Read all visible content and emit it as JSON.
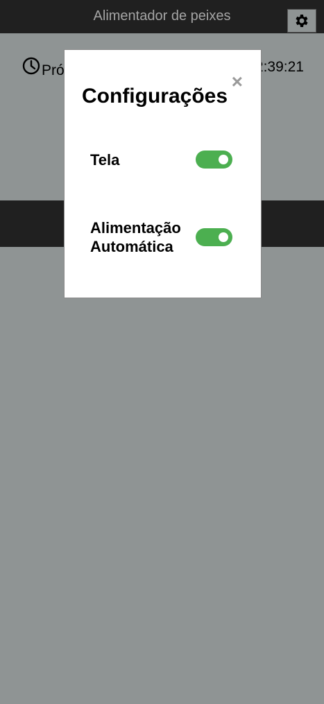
{
  "app": {
    "title": "Alimentador de peixes"
  },
  "next_feed": {
    "label_visible": "Pró",
    "time_visible": "2:39:21"
  },
  "modal": {
    "title": "Configurações",
    "close_label": "×",
    "settings": [
      {
        "label": "Tela",
        "enabled": true
      },
      {
        "label": "Alimentação Automática",
        "enabled": true
      }
    ]
  },
  "colors": {
    "toggle_on": "#4caf50",
    "bar_dark": "#202020",
    "overlay_gray": "#8f9494"
  },
  "icons": {
    "settings": "gear-icon",
    "clock": "clock-icon"
  }
}
